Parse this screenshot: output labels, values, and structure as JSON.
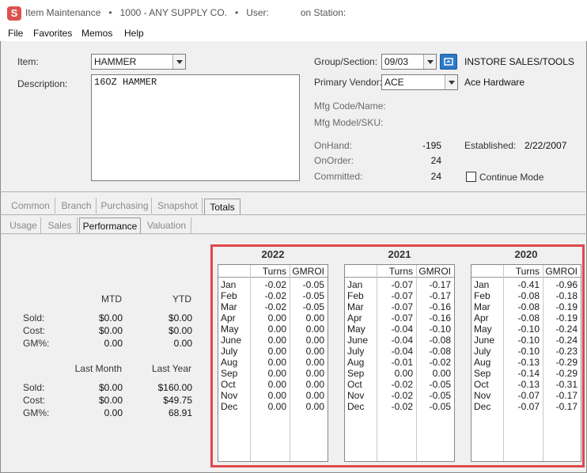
{
  "window": {
    "title": "Item Maintenance   •   1000 - ANY SUPPLY CO.   •   User:            on Station:",
    "icon_letter": "S"
  },
  "menu": [
    "File",
    "Favorites",
    "Memos",
    "Help"
  ],
  "item": {
    "item_label": "Item:",
    "item_value": "HAMMER",
    "description_label": "Description:",
    "description_value": "16OZ HAMMER",
    "group_label": "Group/Section:",
    "group_value": "09/03",
    "group_name": "INSTORE SALES/TOOLS",
    "vendor_label": "Primary Vendor:",
    "vendor_value": "ACE",
    "vendor_name": "Ace Hardware",
    "mfg_code_label": "Mfg Code/Name:",
    "mfg_model_label": "Mfg Model/SKU:",
    "onhand_label": "OnHand:",
    "onhand_value": "-195",
    "onorder_label": "OnOrder:",
    "onorder_value": "24",
    "committed_label": "Committed:",
    "committed_value": "24",
    "established_label": "Established:",
    "established_value": "2/22/2007",
    "continue_label": "Continue Mode"
  },
  "main_tabs": [
    "Common",
    "Branch",
    "Purchasing",
    "Snapshot",
    "Totals"
  ],
  "sub_tabs": [
    "Usage",
    "Sales",
    "Performance",
    "Valuation"
  ],
  "perf": {
    "mtd": "MTD",
    "ytd": "YTD",
    "last_month": "Last Month",
    "last_year": "Last Year",
    "sold": "Sold:",
    "cost": "Cost:",
    "gm": "GM%:",
    "current": {
      "sold_mtd": "$0.00",
      "sold_ytd": "$0.00",
      "cost_mtd": "$0.00",
      "cost_ytd": "$0.00",
      "gm_mtd": "0.00",
      "gm_ytd": "0.00"
    },
    "prior": {
      "sold_lm": "$0.00",
      "sold_ly": "$160.00",
      "cost_lm": "$0.00",
      "cost_ly": "$49.75",
      "gm_lm": "0.00",
      "gm_ly": "68.91"
    }
  },
  "years": [
    {
      "year": "2022",
      "col1": "Turns",
      "col2": "GMROI",
      "rows": [
        [
          "Jan",
          "-0.02",
          "-0.05"
        ],
        [
          "Feb",
          "-0.02",
          "-0.05"
        ],
        [
          "Mar",
          "-0.02",
          "-0.05"
        ],
        [
          "Apr",
          "0.00",
          "0.00"
        ],
        [
          "May",
          "0.00",
          "0.00"
        ],
        [
          "June",
          "0.00",
          "0.00"
        ],
        [
          "July",
          "0.00",
          "0.00"
        ],
        [
          "Aug",
          "0.00",
          "0.00"
        ],
        [
          "Sep",
          "0.00",
          "0.00"
        ],
        [
          "Oct",
          "0.00",
          "0.00"
        ],
        [
          "Nov",
          "0.00",
          "0.00"
        ],
        [
          "Dec",
          "0.00",
          "0.00"
        ]
      ]
    },
    {
      "year": "2021",
      "col1": "Turns",
      "col2": "GMROI",
      "rows": [
        [
          "Jan",
          "-0.07",
          "-0.17"
        ],
        [
          "Feb",
          "-0.07",
          "-0.17"
        ],
        [
          "Mar",
          "-0.07",
          "-0.16"
        ],
        [
          "Apr",
          "-0.07",
          "-0.16"
        ],
        [
          "May",
          "-0.04",
          "-0.10"
        ],
        [
          "June",
          "-0.04",
          "-0.08"
        ],
        [
          "July",
          "-0.04",
          "-0.08"
        ],
        [
          "Aug",
          "-0.01",
          "-0.02"
        ],
        [
          "Sep",
          "0.00",
          "0.00"
        ],
        [
          "Oct",
          "-0.02",
          "-0.05"
        ],
        [
          "Nov",
          "-0.02",
          "-0.05"
        ],
        [
          "Dec",
          "-0.02",
          "-0.05"
        ]
      ]
    },
    {
      "year": "2020",
      "col1": "Turns",
      "col2": "GMROI",
      "rows": [
        [
          "Jan",
          "-0.41",
          "-0.96"
        ],
        [
          "Feb",
          "-0.08",
          "-0.18"
        ],
        [
          "Mar",
          "-0.08",
          "-0.19"
        ],
        [
          "Apr",
          "-0.08",
          "-0.19"
        ],
        [
          "May",
          "-0.10",
          "-0.24"
        ],
        [
          "June",
          "-0.10",
          "-0.24"
        ],
        [
          "July",
          "-0.10",
          "-0.23"
        ],
        [
          "Aug",
          "-0.13",
          "-0.29"
        ],
        [
          "Sep",
          "-0.14",
          "-0.29"
        ],
        [
          "Oct",
          "-0.13",
          "-0.31"
        ],
        [
          "Nov",
          "-0.07",
          "-0.17"
        ],
        [
          "Dec",
          "-0.07",
          "-0.17"
        ]
      ]
    }
  ],
  "colors": {
    "highlight": "#e0484a",
    "nav_button": "#2a78c8",
    "app_icon": "#d9534f"
  }
}
